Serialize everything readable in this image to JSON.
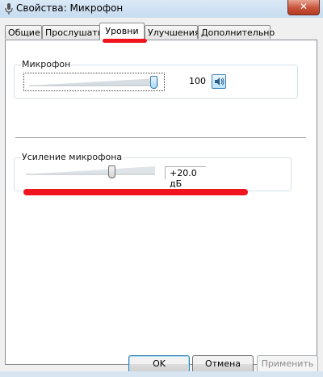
{
  "window": {
    "title": "Свойства: Микрофон",
    "close_glyph": "✕"
  },
  "tabs": [
    {
      "label": "Общие"
    },
    {
      "label": "Прослушать"
    },
    {
      "label": "Уровни",
      "active": true
    },
    {
      "label": "Улучшения"
    },
    {
      "label": "Дополнительно"
    }
  ],
  "microphone": {
    "label": "Микрофон",
    "level": 100,
    "level_text": "100",
    "level_fraction": 1.0,
    "mute_icon": "speaker-icon"
  },
  "boost": {
    "label": "Усиление микрофона",
    "value_text": "+20.0 дБ",
    "level_fraction": 0.67
  },
  "buttons": {
    "ok": "OK",
    "cancel": "Отмена",
    "apply": "Применить"
  },
  "colors": {
    "annotation_red": "#f0141e",
    "accent": "#3c7fb1"
  }
}
